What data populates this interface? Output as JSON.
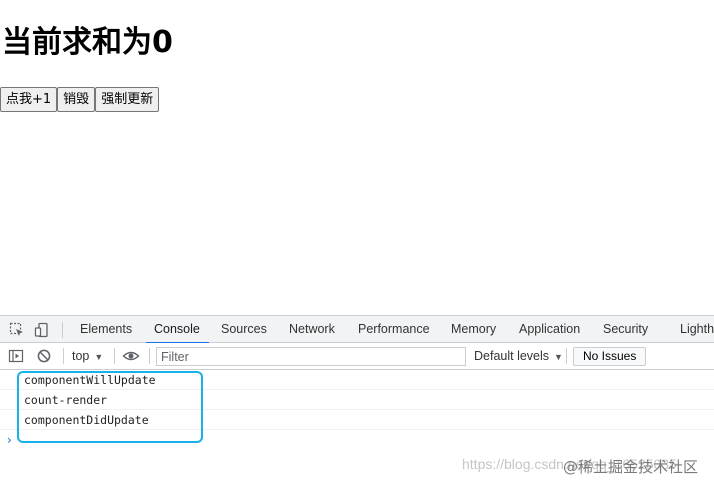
{
  "page": {
    "heading": "当前求和为0",
    "buttons": [
      "点我+1",
      "销毁",
      "强制更新"
    ]
  },
  "devtools": {
    "tabs": [
      "Elements",
      "Console",
      "Sources",
      "Network",
      "Performance",
      "Memory",
      "Application",
      "Security",
      "Lighth"
    ],
    "active_tab": "Console",
    "toolbar": {
      "context": "top",
      "filter_placeholder": "Filter",
      "levels_label": "Default levels",
      "issues_label": "No Issues"
    },
    "console_logs": [
      "componentWillUpdate",
      "count-render",
      "componentDidUpdate"
    ],
    "prompt_symbol": "›",
    "accent_color": "#1a73e8",
    "highlight_color": "#1ab0e8"
  },
  "overlay": {
    "watermark": "https://blog.csdn.net/qq_16525035",
    "brand": "@稀土掘金技术社区"
  }
}
